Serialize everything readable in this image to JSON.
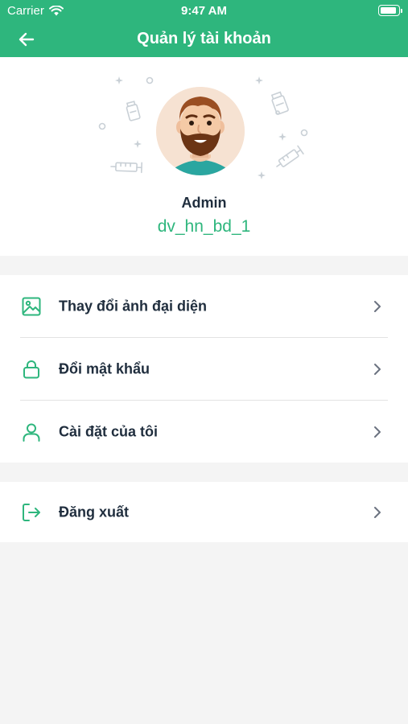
{
  "status_bar": {
    "carrier": "Carrier",
    "time": "9:47 AM",
    "battery_level": 0.95
  },
  "header": {
    "title": "Quản lý tài khoản",
    "back_icon": "arrow-left-icon"
  },
  "profile": {
    "name": "Admin",
    "username": "dv_hn_bd_1"
  },
  "menu": [
    {
      "label": "Thay đổi ảnh đại diện",
      "icon": "image-icon"
    },
    {
      "label": "Đổi mật khẩu",
      "icon": "lock-icon"
    },
    {
      "label": "Cài đặt của tôi",
      "icon": "user-icon"
    }
  ],
  "logout": {
    "label": "Đăng xuất",
    "icon": "logout-icon"
  },
  "colors": {
    "primary": "#2eb67d",
    "text": "#1f2d3d",
    "background": "#f4f4f4"
  }
}
